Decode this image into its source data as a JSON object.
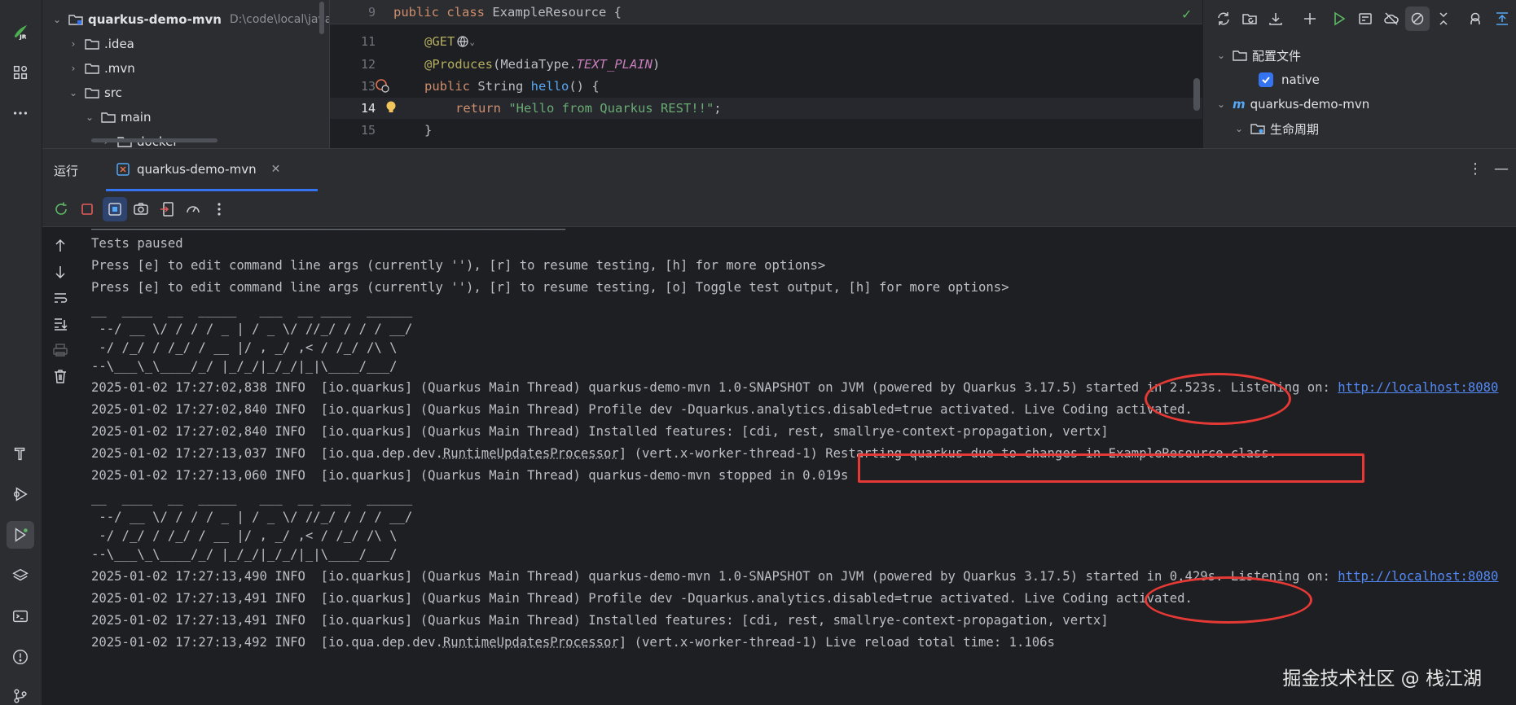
{
  "project_tree": {
    "rows": [
      {
        "name": "quarkus-demo-mvn",
        "path": "D:\\code\\local\\java",
        "expanded": true,
        "bold": true
      },
      {
        "name": ".idea",
        "expanded": false
      },
      {
        "name": ".mvn",
        "expanded": false
      },
      {
        "name": "src",
        "expanded": true
      },
      {
        "name": "main",
        "expanded": true
      },
      {
        "name": "docker",
        "expanded": false
      }
    ]
  },
  "editor": {
    "lines": [
      {
        "num": "9"
      },
      {
        "num": "11"
      },
      {
        "num": "12"
      },
      {
        "num": "13"
      },
      {
        "num": "14"
      },
      {
        "num": "15"
      }
    ],
    "code": {
      "l9_kw": "public class ",
      "l9_name": "ExampleResource {",
      "l11_ann": "@GET",
      "l12_ann": "@Produces",
      "l12_mid": "(MediaType.",
      "l12_const": "TEXT_PLAIN",
      "l12_end": ")",
      "l13_kw": "public ",
      "l13_type": "String ",
      "l13_fn": "hello",
      "l13_end": "() {",
      "l14_kw": "return ",
      "l14_str": "\"Hello from Quarkus REST!!\"",
      "l14_end": ";",
      "l15": "}"
    }
  },
  "maven": {
    "profiles_label": "配置文件",
    "profile_native": "native",
    "project": "quarkus-demo-mvn",
    "lifecycle": "生命周期"
  },
  "run": {
    "panel_title": "运行",
    "tab_label": "quarkus-demo-mvn"
  },
  "console": {
    "lines": [
      "Tests paused",
      "Press [e] to edit command line args (currently ''), [r] to resume testing, [h] for more options>",
      "Press [e] to edit command line args (currently ''), [r] to resume testing, [o] Toggle test output, [h] for more options>",
      "__  ____  __  _____   ___  __ ____  ______ ",
      " --/ __ \\/ / / / _ | / _ \\/ //_/ / / / __/ ",
      " -/ /_/ / /_/ / __ |/ , _/ ,< / /_/ /\\ \\   ",
      "--\\___\\_\\____/_/ |_/_/|_/_/|_|\\____/___/   "
    ],
    "log1_a": "2025-01-02 17:27:02,838 INFO  [io.quarkus] (Quarkus Main Thread) quarkus-demo-mvn 1.0-SNAPSHOT on JVM (powered by Quarkus 3.17.5) started in 2.523s. Listening on: ",
    "log1_link": "http://localhost:8080",
    "log2": "2025-01-02 17:27:02,840 INFO  [io.quarkus] (Quarkus Main Thread) Profile dev -Dquarkus.analytics.disabled=true activated. Live Coding activated.",
    "log3": "2025-01-02 17:27:02,840 INFO  [io.quarkus] (Quarkus Main Thread) Installed features: [cdi, rest, smallrye-context-propagation, vertx]",
    "log4_a": "2025-01-02 17:27:13,037 INFO  [io.qua.dep.dev.",
    "log4_u": "RuntimeUpdatesProcessor",
    "log4_b": "] (vert.x-worker-thread-1) Restarting quarkus due to changes in ExampleResource.class.",
    "log5": "2025-01-02 17:27:13,060 INFO  [io.quarkus] (Quarkus Main Thread) quarkus-demo-mvn stopped in 0.019s",
    "log6_a": "2025-01-02 17:27:13,490 INFO  [io.quarkus] (Quarkus Main Thread) quarkus-demo-mvn 1.0-SNAPSHOT on JVM (powered by Quarkus 3.17.5) started in 0.429s. Listening on: ",
    "log6_link": "http://localhost:8080",
    "log7": "2025-01-02 17:27:13,491 INFO  [io.quarkus] (Quarkus Main Thread) Profile dev -Dquarkus.analytics.disabled=true activated. Live Coding activated.",
    "log8": "2025-01-02 17:27:13,491 INFO  [io.quarkus] (Quarkus Main Thread) Installed features: [cdi, rest, smallrye-context-propagation, vertx]",
    "log9_a": "2025-01-02 17:27:13,492 INFO  [io.qua.dep.dev.",
    "log9_u": "RuntimeUpdatesProcessor",
    "log9_b": "] (vert.x-worker-thread-1) Live reload total time: 1.106s"
  },
  "watermark": "掘金技术社区 @ 栈江湖",
  "colors": {
    "annotation": "#e53935",
    "accent": "#3574f0",
    "link": "#548af7"
  }
}
